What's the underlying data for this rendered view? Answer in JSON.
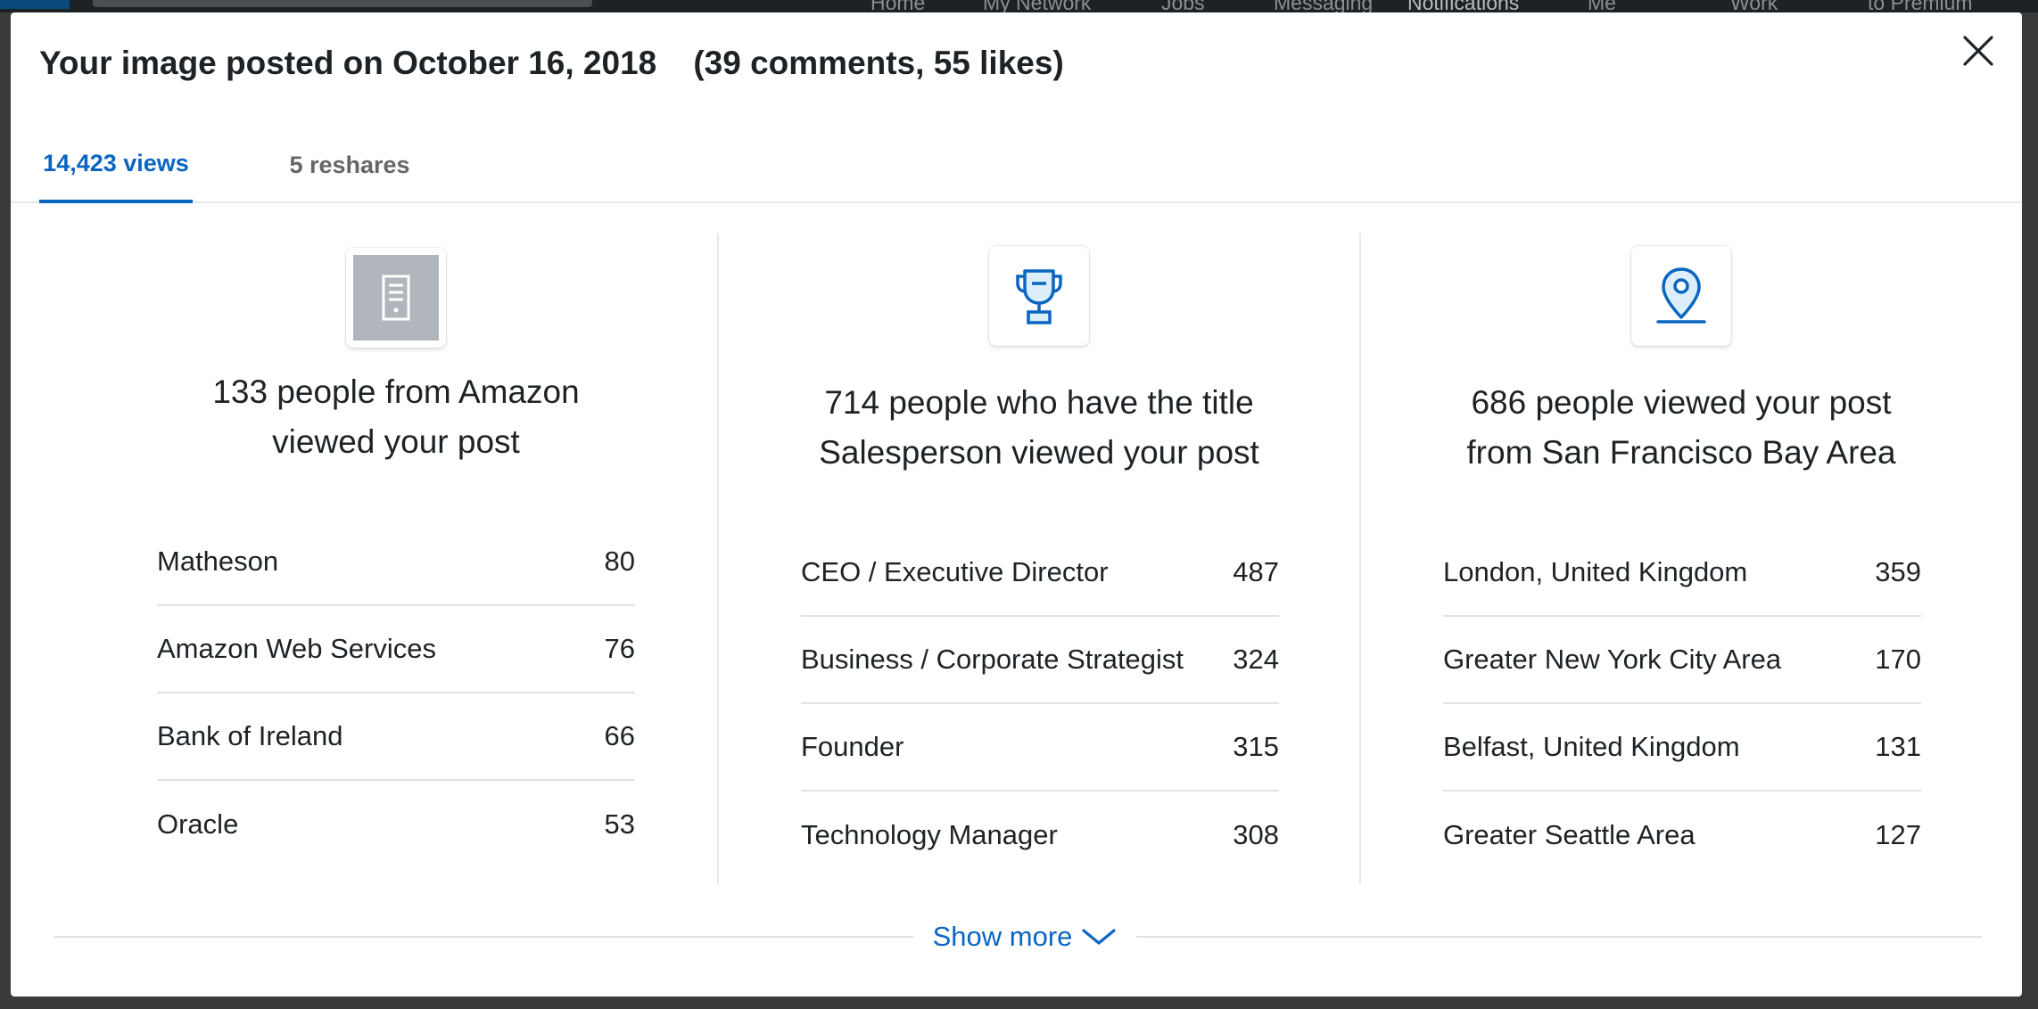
{
  "background_nav": {
    "links": [
      "Home",
      "My Network",
      "Jobs",
      "Messaging",
      "Notifications",
      "Me",
      "Work",
      "to Premium"
    ]
  },
  "modal": {
    "title": "Your image posted on October 16, 2018    (39 comments, 55 likes)",
    "close_icon": "close-icon",
    "tabs": [
      {
        "label": "14,423 views",
        "active": true
      },
      {
        "label": "5 reshares",
        "active": false
      }
    ],
    "columns": [
      {
        "icon": "company-building-icon",
        "headline": "133 people from Amazon viewed your post",
        "rows": [
          {
            "label": "Matheson",
            "value": "80"
          },
          {
            "label": "Amazon Web Services",
            "value": "76"
          },
          {
            "label": "Bank of Ireland",
            "value": "66"
          },
          {
            "label": "Oracle",
            "value": "53"
          }
        ]
      },
      {
        "icon": "trophy-icon",
        "headline": "714 people who have the title Salesperson viewed your post",
        "rows": [
          {
            "label": "CEO / Executive Director",
            "value": "487"
          },
          {
            "label": "Business / Corporate Strategist",
            "value": "324"
          },
          {
            "label": "Founder",
            "value": "315"
          },
          {
            "label": "Technology Manager",
            "value": "308"
          }
        ]
      },
      {
        "icon": "location-pin-icon",
        "headline": "686 people viewed your post from San Francisco Bay Area",
        "rows": [
          {
            "label": "London, United Kingdom",
            "value": "359"
          },
          {
            "label": "Greater New York City Area",
            "value": "170"
          },
          {
            "label": "Belfast, United Kingdom",
            "value": "131"
          },
          {
            "label": "Greater Seattle Area",
            "value": "127"
          }
        ]
      }
    ],
    "show_more": "Show more"
  },
  "colors": {
    "accent": "#0a66c2",
    "text": "#1d2226",
    "muted": "#666666",
    "divider": "#dfe3e6"
  }
}
